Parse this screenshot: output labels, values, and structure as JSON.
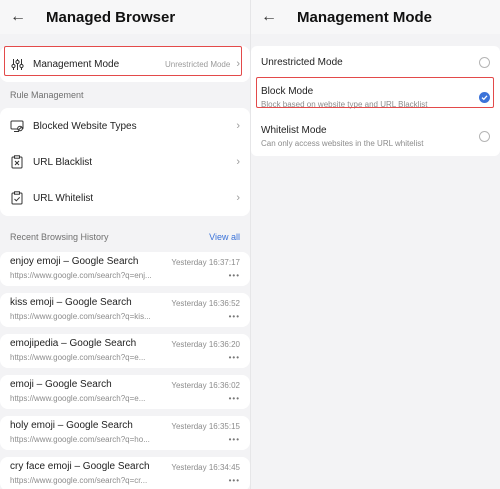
{
  "left": {
    "header": {
      "back_icon": "←",
      "title": "Managed Browser"
    },
    "management_mode": {
      "label": "Management Mode",
      "value": "Unrestricted Mode",
      "icon": "sliders-icon"
    },
    "rule_section_label": "Rule Management",
    "rules": [
      {
        "label": "Blocked Website Types",
        "icon": "monitor-block-icon"
      },
      {
        "label": "URL Blacklist",
        "icon": "clipboard-x-icon"
      },
      {
        "label": "URL Whitelist",
        "icon": "clipboard-check-icon"
      }
    ],
    "history": {
      "title": "Recent Browsing History",
      "view_all": "View all",
      "items": [
        {
          "title": "enjoy emoji – Google Search",
          "url": "https://www.google.com/search?q=enj...",
          "time": "Yesterday 16:37:17"
        },
        {
          "title": "kiss emoji – Google Search",
          "url": "https://www.google.com/search?q=kis...",
          "time": "Yesterday 16:36:52"
        },
        {
          "title": "emojipedia – Google Search",
          "url": "https://www.google.com/search?q=e...",
          "time": "Yesterday 16:36:20"
        },
        {
          "title": "emoji – Google Search",
          "url": "https://www.google.com/search?q=e...",
          "time": "Yesterday 16:36:02"
        },
        {
          "title": "holy emoji – Google Search",
          "url": "https://www.google.com/search?q=ho...",
          "time": "Yesterday 16:35:15"
        },
        {
          "title": "cry face emoji – Google Search",
          "url": "https://www.google.com/search?q=cr...",
          "time": "Yesterday 16:34:45"
        }
      ],
      "more": "•••"
    }
  },
  "right": {
    "header": {
      "back_icon": "←",
      "title": "Management Mode"
    },
    "modes": [
      {
        "title": "Unrestricted Mode",
        "desc": "",
        "selected": false
      },
      {
        "title": "Block Mode",
        "desc": "Block based on website type and URL Blacklist",
        "selected": true
      },
      {
        "title": "Whitelist Mode",
        "desc": "Can only access websites in the URL whitelist",
        "selected": false
      }
    ]
  },
  "colors": {
    "accent": "#3b73d9",
    "highlight": "#e34a4a"
  }
}
